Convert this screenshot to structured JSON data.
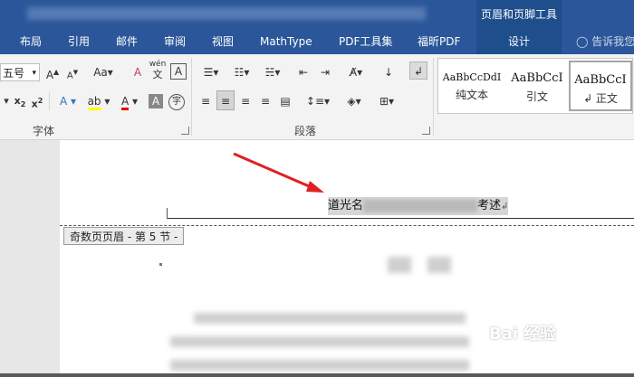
{
  "titlebar": {
    "context_group": "页眉和页脚工具"
  },
  "tabs": [
    {
      "label": "布局"
    },
    {
      "label": "引用"
    },
    {
      "label": "邮件"
    },
    {
      "label": "审阅"
    },
    {
      "label": "视图"
    },
    {
      "label": "MathType"
    },
    {
      "label": "PDF工具集"
    },
    {
      "label": "福昕PDF"
    },
    {
      "label": "设计"
    }
  ],
  "tell_me": "告诉我您",
  "ribbon": {
    "font_size": "五号",
    "font_group_label": "字体",
    "paragraph_group_label": "段落",
    "wen_label_top": "wén",
    "wen_label_bottom": "文",
    "styles": [
      {
        "sample": "AaBbCcDdI",
        "name": "纯文本"
      },
      {
        "sample": "AaBbCcI",
        "name": "引文"
      },
      {
        "sample": "AaBbCcI",
        "name": "↲ 正文"
      }
    ]
  },
  "document": {
    "section_tag": "奇数页页眉 - 第 5 节 -",
    "header_prefix": "道光名",
    "header_suffix": "考述",
    "header_mark": "↲"
  },
  "watermark": "Bai 经验",
  "colors": {
    "ribbon_blue": "#2b579a",
    "arrow_red": "#e02020"
  }
}
